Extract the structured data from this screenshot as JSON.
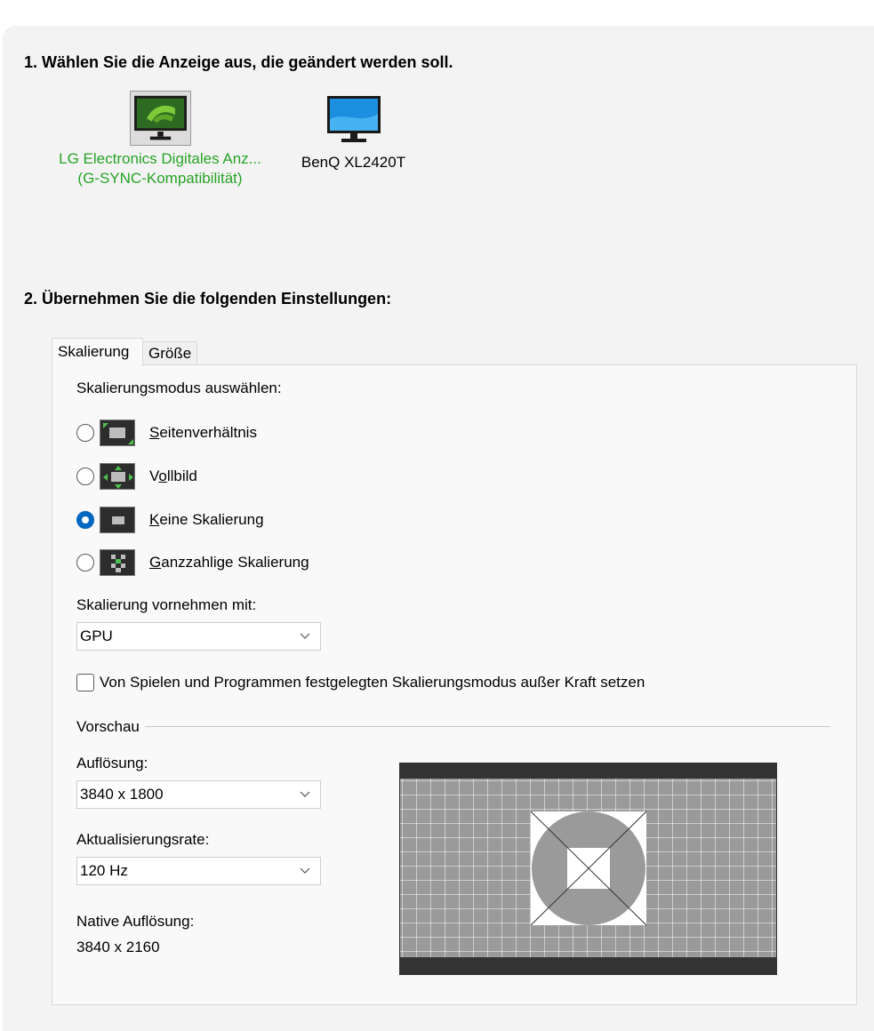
{
  "step1": {
    "title": "1. Wählen Sie die Anzeige aus, die geändert werden soll."
  },
  "displays": [
    {
      "line1": "LG Electronics Digitales Anz...",
      "line2": "(G-SYNC-Kompatibilität)",
      "selected": true,
      "icon": "nvidia-monitor-icon"
    },
    {
      "line1": "BenQ XL2420T",
      "line2": "",
      "selected": false,
      "icon": "monitor-icon"
    }
  ],
  "step2": {
    "title": "2. Übernehmen Sie die folgenden Einstellungen:"
  },
  "tabs": [
    {
      "label": "Skalierung",
      "active": true
    },
    {
      "label": "Größe",
      "active": false
    }
  ],
  "scaling": {
    "mode_heading": "Skalierungsmodus auswählen:",
    "modes": [
      {
        "access_key": "S",
        "rest": "eitenverhältnis",
        "selected": false,
        "icon": "aspect-ratio-icon"
      },
      {
        "prefix": "V",
        "access_key": "o",
        "rest": "llbild",
        "selected": false,
        "icon": "fullscreen-icon"
      },
      {
        "access_key": "K",
        "rest": "eine Skalierung",
        "selected": true,
        "icon": "no-scaling-icon"
      },
      {
        "access_key": "G",
        "rest": "anzzahlige Skalierung",
        "selected": false,
        "icon": "integer-scaling-icon"
      }
    ],
    "perform_label": "Skalierung vornehmen mit:",
    "perform_value": "GPU",
    "override_label": "Von Spielen und Programmen festgelegten Skalierungsmodus außer Kraft setzen",
    "override_checked": false
  },
  "preview": {
    "group_label": "Vorschau",
    "resolution_label": "Auflösung:",
    "resolution_value": "3840 x 1800",
    "refresh_label": "Aktualisierungsrate:",
    "refresh_value": "120 Hz",
    "native_label": "Native Auflösung:",
    "native_value": "3840 x 2160"
  },
  "colors": {
    "selected_display_text": "#27a327",
    "radio_accent": "#0067c0",
    "panel_bg": "#f3f3f3"
  }
}
